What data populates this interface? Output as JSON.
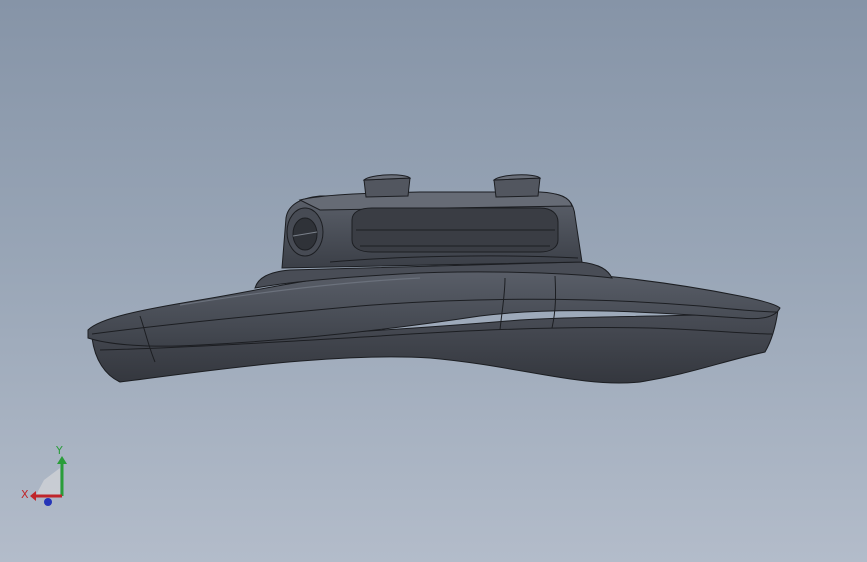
{
  "viewport": {
    "background_top": "#8694a7",
    "background_bottom": "#b3bcca"
  },
  "model": {
    "body_color": "#3f434c",
    "edge_color": "#1c1e22",
    "highlight_color": "#6b717c"
  },
  "triad": {
    "x_label": "X",
    "y_label": "Y",
    "x_color": "#c0262b",
    "y_color": "#2a9d3a",
    "z_color": "#2535b8"
  }
}
